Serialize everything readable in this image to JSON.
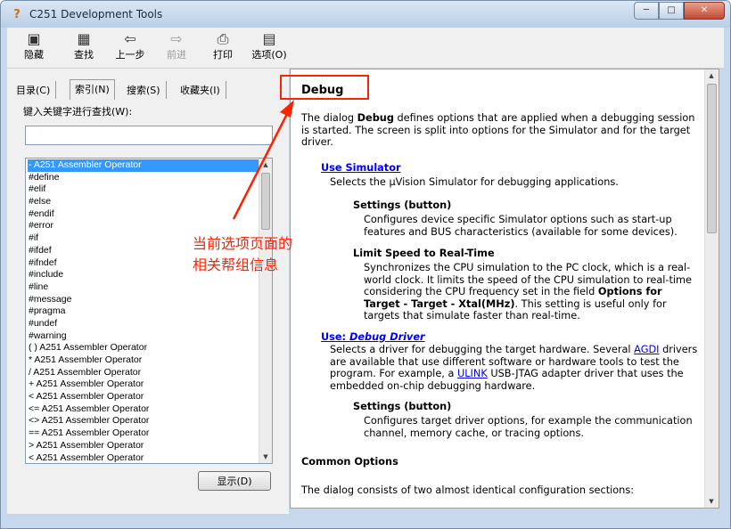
{
  "window": {
    "title": "C251 Development Tools",
    "controls": {
      "minimize": "─",
      "maximize": "□",
      "close": "✕"
    }
  },
  "toolbar": {
    "buttons": [
      {
        "label": "隐藏",
        "icon": "hide-icon",
        "glyph": "▣"
      },
      {
        "label": "查找",
        "icon": "locate-icon",
        "glyph": "▦"
      },
      {
        "label": "上一步",
        "icon": "back-icon",
        "glyph": "⇦"
      },
      {
        "label": "前进",
        "icon": "forward-icon",
        "glyph": "⇨"
      },
      {
        "label": "打印",
        "icon": "print-icon",
        "glyph": "⎙"
      },
      {
        "label": "选项(O)",
        "icon": "options-icon",
        "glyph": "▤"
      }
    ]
  },
  "nav": {
    "tabs": [
      {
        "label": "目录(C)"
      },
      {
        "label": "索引(N)"
      },
      {
        "label": "搜索(S)"
      },
      {
        "label": "收藏夹(I)"
      }
    ],
    "active_tab": "索引(N)",
    "keyword_label": "键入关键字进行查找(W):",
    "keyword_value": "",
    "index_items": [
      "- A251 Assembler Operator",
      "#define",
      "#elif",
      "#else",
      "#endif",
      "#error",
      "#if",
      "#ifdef",
      "#ifndef",
      "#include",
      "#line",
      "#message",
      "#pragma",
      "#undef",
      "#warning",
      "( ) A251 Assembler Operator",
      "* A251 Assembler Operator",
      "/ A251 Assembler Operator",
      "+ A251 Assembler Operator",
      "< A251 Assembler Operator",
      "<= A251 Assembler Operator",
      "<> A251 Assembler Operator",
      "== A251 Assembler Operator",
      "> A251 Assembler Operator",
      "< A251 Assembler Operator"
    ],
    "selected_index": 0,
    "show_button": "显示(D)"
  },
  "help": {
    "heading": "Debug",
    "intro_a": "The dialog ",
    "intro_b": "Debug",
    "intro_c": " defines options that are applied when a debugging session is started. The screen is split into options for the Simulator and for the target driver.",
    "use_sim_link": "Use Simulator",
    "use_sim_desc": "Selects the µVision Simulator for debugging applications.",
    "settings1_title": "Settings (button)",
    "settings1_desc": "Configures device specific Simulator options such as start-up features and BUS characteristics (available for some devices).",
    "limit_title": "Limit Speed to Real-Time",
    "limit_desc_a": "Synchronizes the CPU simulation to the PC clock, which is a real-world clock. It limits the speed of the CPU simulation to real-time considering the CPU frequency set in the field ",
    "limit_desc_b": "Options for Target - Target - Xtal(MHz)",
    "limit_desc_c": ". This setting is useful only for targets that simulate faster than real-time.",
    "use_label": "Use: ",
    "use_driver_link": "Debug Driver",
    "driver_desc_a": "Selects a driver for debugging the target hardware. Several ",
    "agdi_link": "AGDI",
    "driver_desc_b": " drivers are available that use different software or hardware tools to test the program. For example, a ",
    "ulink_link": "ULINK",
    "driver_desc_c": " USB-JTAG adapter driver that uses the embedded on-chip debugging hardware.",
    "settings2_title": "Settings (button)",
    "settings2_desc": "Configures target driver options, for example the communication channel, memory cache, or tracing options.",
    "common_heading": "Common Options",
    "common_desc": "The dialog consists of two almost identical configuration sections:"
  },
  "annotation": {
    "line1": "当前选项页面的",
    "line2": "相关帮组信息",
    "color": "#ff2200"
  }
}
